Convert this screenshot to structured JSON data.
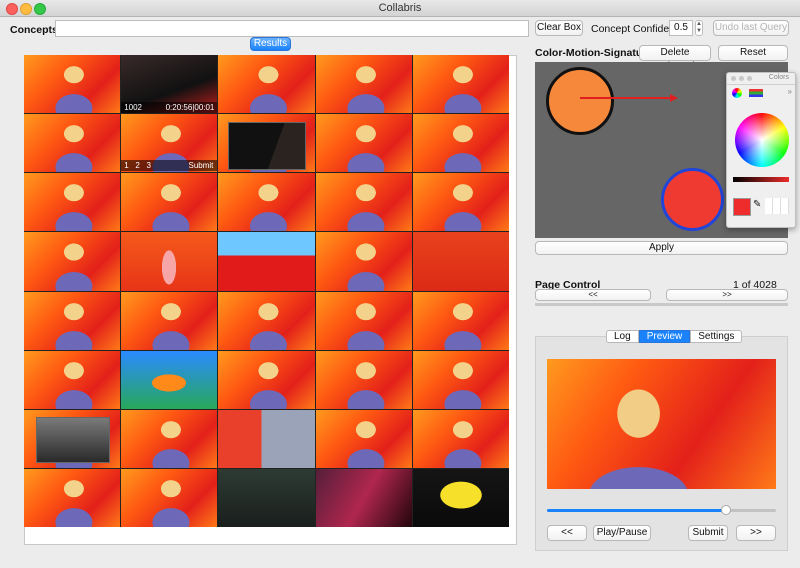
{
  "window": {
    "title": "Collabris"
  },
  "toolbar": {
    "concepts_label": "Concepts:",
    "concepts_value": "",
    "clear_box": "Clear Box",
    "confidence_label": "Concept Confidence:",
    "confidence_value": "0.5",
    "undo": "Undo last Query"
  },
  "results": {
    "tab_label": "Results",
    "cell_overlay": {
      "frame_id": "1002",
      "timecode": "0:20:56|00:01",
      "pages": [
        "1",
        "2",
        "3"
      ],
      "submit": "Submit"
    }
  },
  "cms": {
    "title": "Color-Motion-Signature",
    "delete_selected": "Delete Selected",
    "reset_features": "Reset Features",
    "apply": "Apply",
    "circle1_color": "#f5883a",
    "circle2_color": "#ef3a32",
    "arrow_color": "#e02020"
  },
  "colors_panel": {
    "title": "Colors",
    "selected_color": "#ee2c2c"
  },
  "page_control": {
    "title": "Page Control",
    "page_status": "1 of 4028",
    "prev": "<<",
    "next": ">>"
  },
  "bottom_tabs": {
    "log": "Log",
    "preview": "Preview",
    "settings": "Settings"
  },
  "player": {
    "position": 0.78,
    "prev": "<<",
    "play_pause": "Play/Pause",
    "submit": "Submit",
    "next": ">>"
  }
}
